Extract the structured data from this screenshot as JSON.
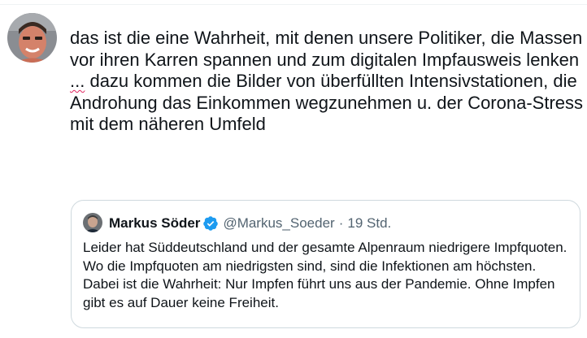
{
  "tweet": {
    "avatar_icon": "user-avatar-photo",
    "text_before": "das ist die eine Wahrheit, mit denen unsere Politiker, die Massen vor ihren Karren spannen und zum digitalen Impfausweis lenken ",
    "text_ellipsis": "...",
    "text_after": " dazu kommen die Bilder von überfüllten Intensivstationen, die Androhung das Einkommen wegzunehmen u. der Corona-Stress mit dem näheren Umfeld"
  },
  "quote": {
    "author_name": "Markus Söder",
    "verified_icon": "verified-badge-icon",
    "handle": "@Markus_Soeder",
    "separator": "·",
    "time": "19 Std.",
    "text": "Leider hat Süddeutschland und der gesamte Alpenraum niedrigere Impfquoten. Wo die Impfquoten am niedrigsten sind, sind die Infektionen am höchsten. Dabei ist die Wahrheit: Nur Impfen führt uns aus der Pandemie. Ohne Impfen gibt es auf Dauer keine Freiheit."
  },
  "colors": {
    "text_primary": "#0f1419",
    "text_secondary": "#536471",
    "verified_blue": "#1d9bf0",
    "border": "#cfd9de",
    "spellcheck_red": "#e0245e"
  }
}
